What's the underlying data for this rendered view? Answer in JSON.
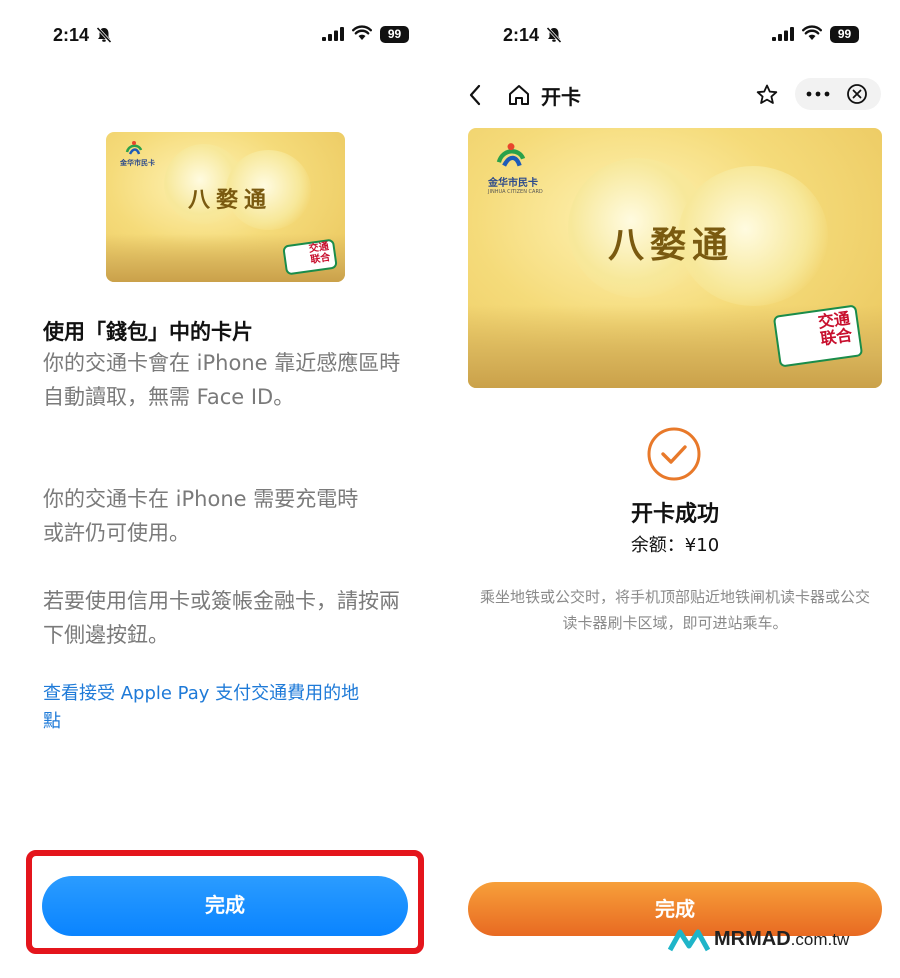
{
  "left": {
    "status": {
      "time": "2:14",
      "battery": "99"
    },
    "card": {
      "name": "八婺通",
      "logo_text": "金华市民卡",
      "badge_top": "交通",
      "badge_bottom": "联合",
      "badge_latin": "CHINA T-UNION"
    },
    "title": "使用「錢包」中的卡片",
    "paragraphs": [
      "你的交通卡會在 iPhone 靠近感應區時自動讀取，無需 Face ID。",
      "你的交通卡在 iPhone 需要充電時或許仍可使用。",
      "若要使用信用卡或簽帳金融卡，請按兩下側邊按鈕。"
    ],
    "link": "查看接受 Apple Pay 支付交通費用的地點",
    "done_button": "完成"
  },
  "right": {
    "status": {
      "time": "2:14",
      "battery": "99"
    },
    "nav": {
      "title": "开卡"
    },
    "card": {
      "name": "八婺通",
      "logo_text": "金华市民卡",
      "logo_sub": "JINHUA CITIZEN CARD",
      "badge_top": "交通",
      "badge_bottom": "联合",
      "badge_latin": "CHINA T-UNION"
    },
    "success": "开卡成功",
    "balance": "余额：¥10",
    "tip": "乘坐地铁或公交时，将手机顶部贴近地铁闸机读卡器或公交读卡器刷卡区域，即可进站乘车。",
    "done_button": "完成"
  },
  "watermark": {
    "brand": "MRMAD",
    "suffix": ".com.tw"
  },
  "colors": {
    "blue_button": "#0a84ff",
    "orange_button": "#e86a22",
    "link": "#1e7ad8",
    "highlight": "#e4151c",
    "success_ring": "#e8792a"
  }
}
